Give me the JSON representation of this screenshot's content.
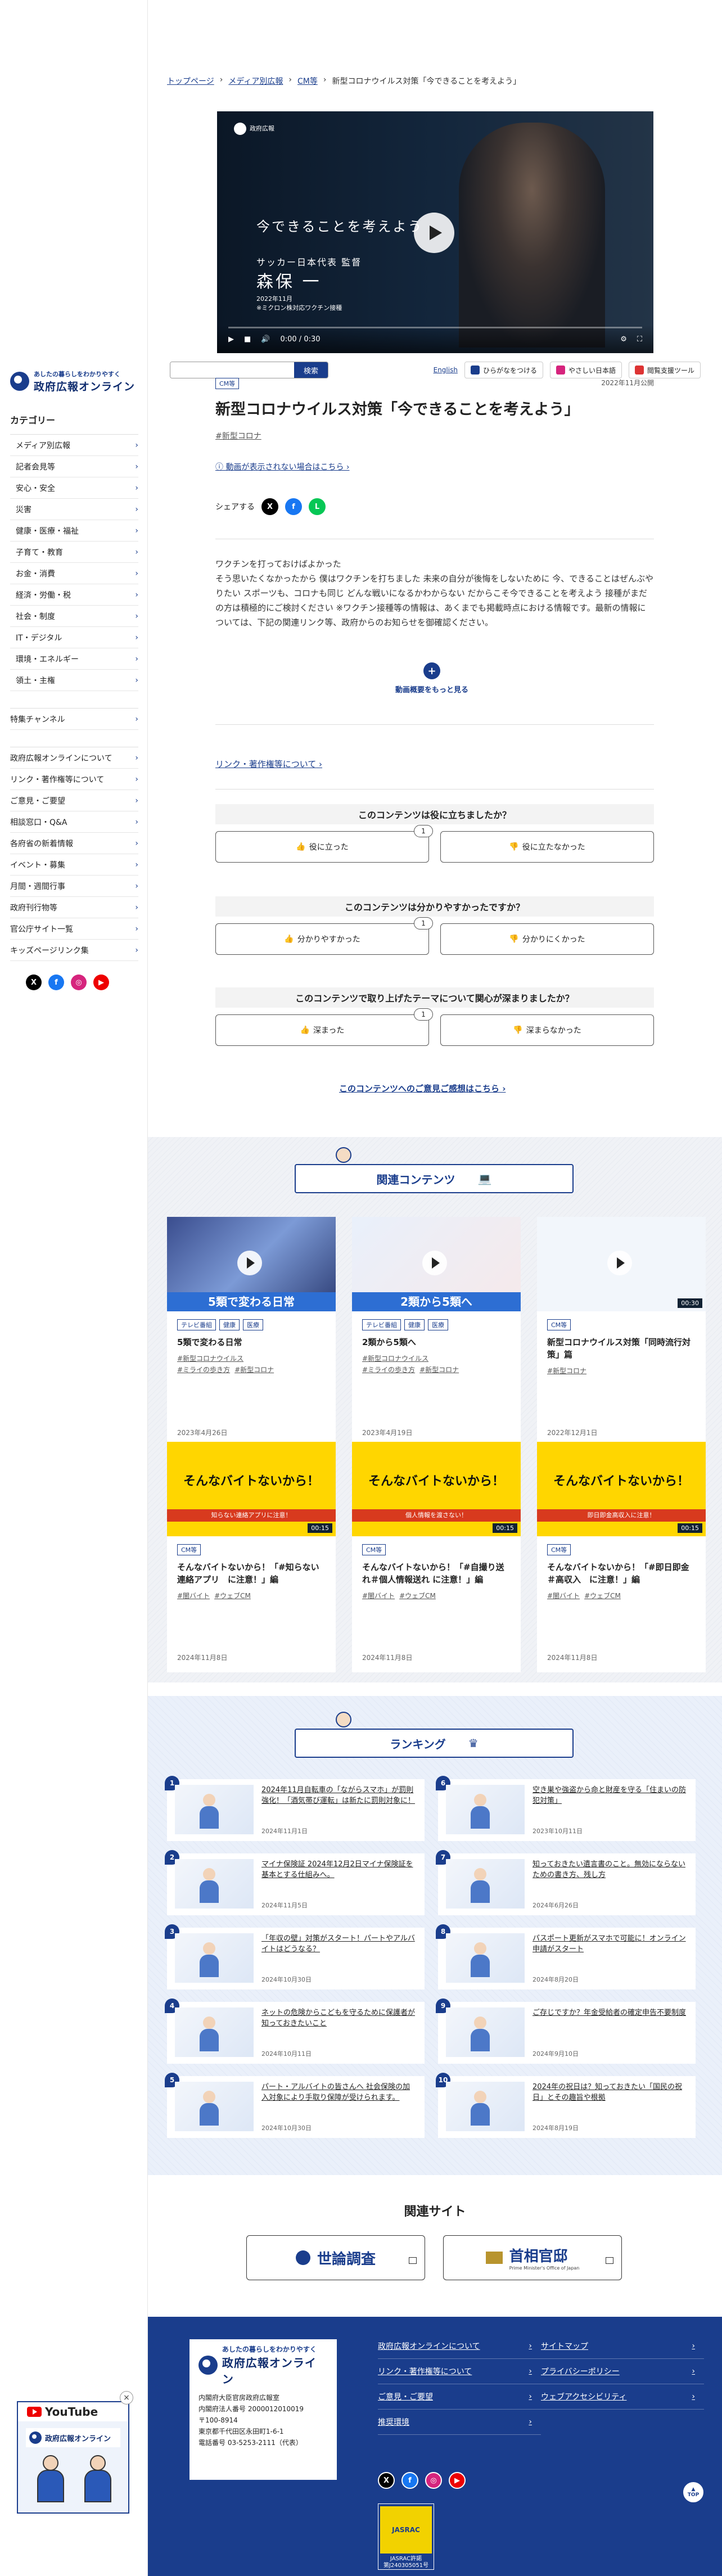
{
  "breadcrumb": {
    "items": [
      "トップページ",
      "メディア別広報",
      "CM等",
      "新型コロナウイルス対策「今できることを考えよう」"
    ]
  },
  "video": {
    "logo": "政府広報",
    "headline": "今できることを考えよう",
    "role": "サッカー日本代表 監督",
    "name": "森保 一",
    "date": "2022年11月",
    "note": "※ミクロン株対応ワクチン接種",
    "time": "0:00 / 0:30"
  },
  "sidebar": {
    "logo_sub": "あしたの暮らしをわかりやすく",
    "logo_main": "政府広報オンライン",
    "category_title": "カテゴリー",
    "categories": [
      "メディア別広報",
      "記者会見等",
      "安心・安全",
      "災害",
      "健康・医療・福祉",
      "子育て・教育",
      "お金・消費",
      "経済・労働・税",
      "社会・制度",
      "IT・デジタル",
      "環境・エネルギー",
      "領土・主権"
    ],
    "special": [
      "特集チャンネル"
    ],
    "info": [
      "政府広報オンラインについて",
      "リンク・著作権等について",
      "ご意見・ご要望",
      "相談窓口・Q&A",
      "各府省の新着情報",
      "イベント・募集",
      "月間・週間行事",
      "政府刊行物等",
      "官公庁サイト一覧",
      "キッズページリンク集"
    ]
  },
  "topbar": {
    "search_button": "検索",
    "lang": "English",
    "furigana": "ひらがなをつける",
    "easy": "やさしい日本語",
    "tools": "閲覧支援ツール"
  },
  "article": {
    "badge": "CM等",
    "date": "2022年11月公開",
    "title": "新型コロナウイルス対策「今できることを考えよう」",
    "tag": "#新型コロナ",
    "help_link": "動画が表示されない場合はこちら",
    "share_label": "シェアする",
    "description": "ワクチンを打っておけばよかった\nそう思いたくなかったから 僕はワクチンを打ちました 未来の自分が後悔をしないために 今、できることはぜんぶやりたい スポーツも、コロナも同じ どんな戦いになるかわからない だからこそ今できることを考えよう 接種がまだの方は積極的にご検討ください ※ワクチン接種等の情報は、あくまでも掲載時点における情報です。最新の情報については、下記の関連リンク等、政府からのお知らせを御確認ください。",
    "more": "動画概要をもっと見る",
    "related_link": "リンク・著作権等について"
  },
  "surveys": [
    {
      "question": "このコンテンツは役に立ちましたか？",
      "yes": "役に立った",
      "no": "役に立たなかった",
      "count": "1"
    },
    {
      "question": "このコンテンツは分かりやすかったですか？",
      "yes": "分かりやすかった",
      "no": "分かりにくかった",
      "count": "1"
    },
    {
      "question": "このコンテンツで取り上げたテーマについて関心が深まりましたか？",
      "yes": "深まった",
      "no": "深まらなかった",
      "count": "1"
    }
  ],
  "feedback_link": "このコンテンツへのご意見ご感想はこちら",
  "related": {
    "title": "関連コンテンツ",
    "cards": [
      {
        "thumb_caption": "5類で変わる日常",
        "duration": "",
        "badges": [
          "テレビ番組",
          "健康",
          "医療"
        ],
        "title": "5類で変わる日常",
        "tags": [
          "#新型コロナウイルス",
          "#ミライの歩き方",
          "#新型コロナ"
        ],
        "date": "2023年4月26日"
      },
      {
        "thumb_caption": "2類から5類へ",
        "duration": "",
        "badges": [
          "テレビ番組",
          "健康",
          "医療"
        ],
        "title": "2類から5類へ",
        "tags": [
          "#新型コロナウイルス",
          "#ミライの歩き方",
          "#新型コロナ"
        ],
        "date": "2023年4月19日"
      },
      {
        "thumb_caption": "",
        "duration": "00:30",
        "badges": [
          "CM等"
        ],
        "title": "新型コロナウイルス対策「同時流行対策」篇",
        "tags": [
          "#新型コロナ"
        ],
        "date": "2022年12月1日"
      },
      {
        "thumb_caption": "そんなバイトないから！",
        "duration": "00:15",
        "band": "知らない連絡アプリに注意！",
        "badges": [
          "CM等"
        ],
        "title": "そんなバイトないから！「#知らない連絡アプリ　に注意！」編",
        "tags": [
          "#闇バイト",
          "#ウェブCM"
        ],
        "date": "2024年11月8日"
      },
      {
        "thumb_caption": "そんなバイトないから！",
        "duration": "00:15",
        "band": "個人情報を渡さない！",
        "badges": [
          "CM等"
        ],
        "title": "そんなバイトないから！「#自撮り送れ＃個人情報送れ に注意！」編",
        "tags": [
          "#闇バイト",
          "#ウェブCM"
        ],
        "date": "2024年11月8日"
      },
      {
        "thumb_caption": "そんなバイトないから！",
        "duration": "00:15",
        "band": "即日即金高収入に注意！",
        "badges": [
          "CM等"
        ],
        "title": "そんなバイトないから！「#即日即金＃高収入　に注意！」編",
        "tags": [
          "#闇バイト",
          "#ウェブCM"
        ],
        "date": "2024年11月8日"
      }
    ]
  },
  "ranking": {
    "title": "ランキング",
    "items": [
      {
        "num": "1",
        "title": "2024年11月自転車の「ながらスマホ」が罰則強化！「酒気帯び運転」は新たに罰則対象に！",
        "date": "2024年11月1日"
      },
      {
        "num": "6",
        "title": "空き巣や強盗から命と財産を守る「住まいの防犯対策」",
        "date": "2023年10月11日"
      },
      {
        "num": "2",
        "title": "マイナ保険証 2024年12月2日マイナ保険証を基本とする仕組みへ。",
        "date": "2024年11月5日"
      },
      {
        "num": "7",
        "title": "知っておきたい遺言書のこと。無効にならないための書き方、残し方",
        "date": "2024年6月26日"
      },
      {
        "num": "3",
        "title": "「年収の壁」対策がスタート！パートやアルバイトはどうなる？",
        "date": "2024年10月30日"
      },
      {
        "num": "8",
        "title": "パスポート更新がスマホで可能に！オンライン申請がスタート",
        "date": "2024年8月20日"
      },
      {
        "num": "4",
        "title": "ネットの危険からこどもを守るために保護者が知っておきたいこと",
        "date": "2024年10月11日"
      },
      {
        "num": "9",
        "title": "ご存じですか？年金受給者の確定申告不要制度",
        "date": "2024年9月10日"
      },
      {
        "num": "5",
        "title": "パート・アルバイトの皆さんへ 社会保険の加入対象により手取り保障が受けられます。",
        "date": "2024年10月30日"
      },
      {
        "num": "10",
        "title": "2024年の祝日は？知っておきたい「国民の祝日」とその趣旨や根拠",
        "date": "2024年8月19日"
      }
    ]
  },
  "related_sites": {
    "title": "関連サイト",
    "sites": [
      {
        "name": "世論調査",
        "sub": ""
      },
      {
        "name": "首相官邸",
        "sub": "Prime Minister's Office of Japan"
      }
    ]
  },
  "footer": {
    "logo_sub": "あしたの暮らしをわかりやすく",
    "logo_main": "政府広報オンライン",
    "address": "内閣府大臣官房政府広報室\n内閣府法人番号 2000012010019\n〒100-8914\n東京都千代田区永田町1-6-1\n電話番号 03-5253-2111（代表）",
    "links": [
      "政府広報オンラインについて",
      "サイトマップ",
      "リンク・著作権等について",
      "プライバシーポリシー",
      "ご意見・ご要望",
      "ウェブアクセシビリティ",
      "推奨環境"
    ],
    "jasrac_box": "JASRAC",
    "jasrac_text": "JASRAC許諾\n第J240305051号",
    "to_top": "TOP"
  },
  "youtube_widget": {
    "label": "YouTube",
    "logo_text": "政府広報オンライン"
  }
}
